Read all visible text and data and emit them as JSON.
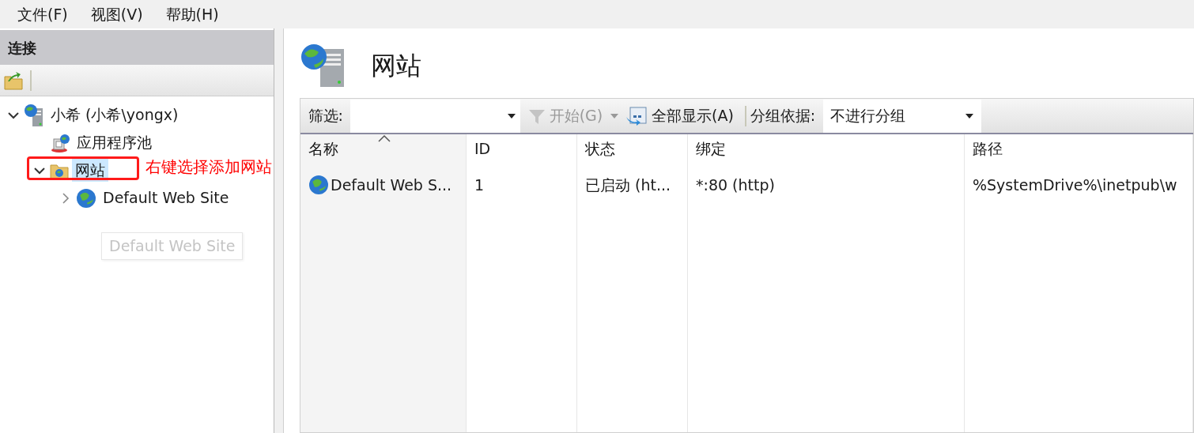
{
  "menu": [
    {
      "label": "文件(F)"
    },
    {
      "label": "视图(V)"
    },
    {
      "label": "帮助(H)"
    }
  ],
  "connections": {
    "title": "连接",
    "tree": [
      {
        "label": "小希 (小希\\yongx)",
        "kind": "server",
        "expanded": true,
        "selected": false,
        "children": [
          {
            "label": "应用程序池",
            "kind": "pool",
            "selected": false
          },
          {
            "label": "网站",
            "kind": "folder",
            "expanded": true,
            "selected": true,
            "children": [
              {
                "label": "Default Web Site",
                "kind": "globe",
                "expanded": false,
                "selected": false
              }
            ]
          }
        ]
      }
    ]
  },
  "tooltip": "Default Web Site",
  "annotation": "右键选择添加网站",
  "content": {
    "title": "网站",
    "filter": {
      "label": "筛选:"
    },
    "start_button": {
      "label": "开始(G)",
      "disabled": true
    },
    "show_all_button": {
      "label": "全部显示(A)",
      "disabled": false
    },
    "group_by": {
      "label": "分组依据:",
      "value": "不进行分组"
    }
  },
  "table": {
    "columns": [
      {
        "label": "名称",
        "sorted": true
      },
      {
        "label": "ID",
        "sorted": false
      },
      {
        "label": "状态",
        "sorted": false
      },
      {
        "label": "绑定",
        "sorted": false
      },
      {
        "label": "路径",
        "sorted": false
      }
    ],
    "rows": [
      {
        "cells": [
          "Default Web S...",
          "1",
          "已启动 (ht...",
          "*:80 (http)",
          "%SystemDrive%\\inetpub\\w"
        ]
      }
    ]
  }
}
